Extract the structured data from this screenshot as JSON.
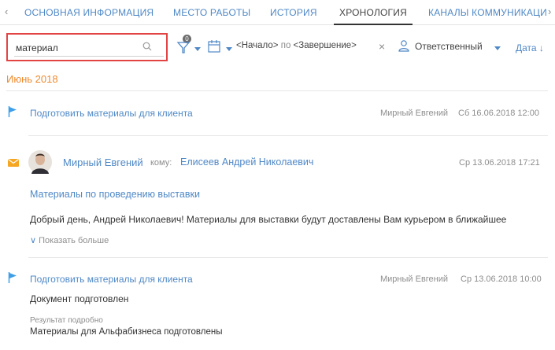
{
  "tabs": {
    "items": [
      {
        "label": "ОСНОВНАЯ ИНФОРМАЦИЯ"
      },
      {
        "label": "МЕСТО РАБОТЫ"
      },
      {
        "label": "ИСТОРИЯ"
      },
      {
        "label": "ХРОНОЛОГИЯ"
      },
      {
        "label": "КАНАЛЫ КОММУНИКАЦИ"
      }
    ],
    "active_index": 3
  },
  "toolbar": {
    "search_value": "материал",
    "filter_badge": "0",
    "period_start": "<Начало>",
    "period_sep": "по",
    "period_end": "<Завершение>",
    "owner_label": "Ответственный",
    "sort_label": "Дата"
  },
  "timeline": {
    "month": "Июнь 2018",
    "items": [
      {
        "type": "task",
        "title": "Подготовить материалы для клиента",
        "author": "Мирный Евгений",
        "date": "Сб 16.06.2018 12:00"
      },
      {
        "type": "email",
        "from": "Мирный Евгений",
        "to_label": "кому:",
        "to": "Елисеев Андрей Николаевич",
        "date": "Ср 13.06.2018 17:21",
        "subject": "Материалы по проведению выставки",
        "body": "Добрый день, Андрей Николаевич! Материалы для выставки будут доставлены Вам курьером в ближайшее",
        "show_more": "Показать больше"
      },
      {
        "type": "task",
        "title": "Подготовить материалы для клиента",
        "author": "Мирный Евгений",
        "date": "Ср 13.06.2018 10:00",
        "note": "Документ подготовлен",
        "result_label": "Результат подробно",
        "result_text": "Материалы для Альфабизнеса подготовлены"
      }
    ]
  },
  "colors": {
    "accent": "#4f88c6",
    "month": "#f08a2d",
    "flag": "#3f9fe8",
    "email_icon": "#f5a623",
    "highlight": "#e24444"
  }
}
